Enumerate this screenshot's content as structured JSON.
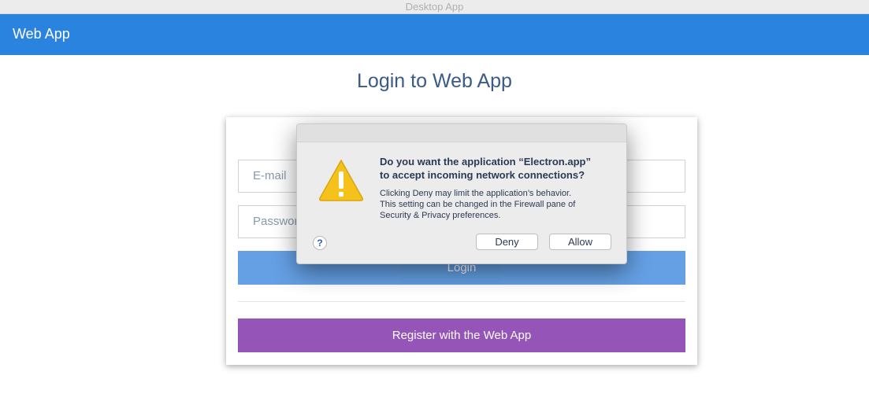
{
  "window": {
    "title": "Desktop App"
  },
  "navbar": {
    "brand": "Web App",
    "color": "#2b83e0"
  },
  "page": {
    "title": "Login to Web App"
  },
  "form": {
    "email_placeholder": "E-mail",
    "password_placeholder": "Password",
    "login_label": "Login",
    "register_label": "Register with the Web App",
    "login_color": "#4a8fe0",
    "register_color": "#9554b8"
  },
  "dialog": {
    "heading_line1": "Do you want the application “Electron.app”",
    "heading_line2": "to accept incoming network connections?",
    "body_line1": "Clicking Deny may limit the application’s behavior.",
    "body_line2": "This setting can be changed in the Firewall pane of",
    "body_line3": "Security & Privacy preferences.",
    "help_label": "?",
    "deny_label": "Deny",
    "allow_label": "Allow",
    "icon": "warning-icon"
  }
}
